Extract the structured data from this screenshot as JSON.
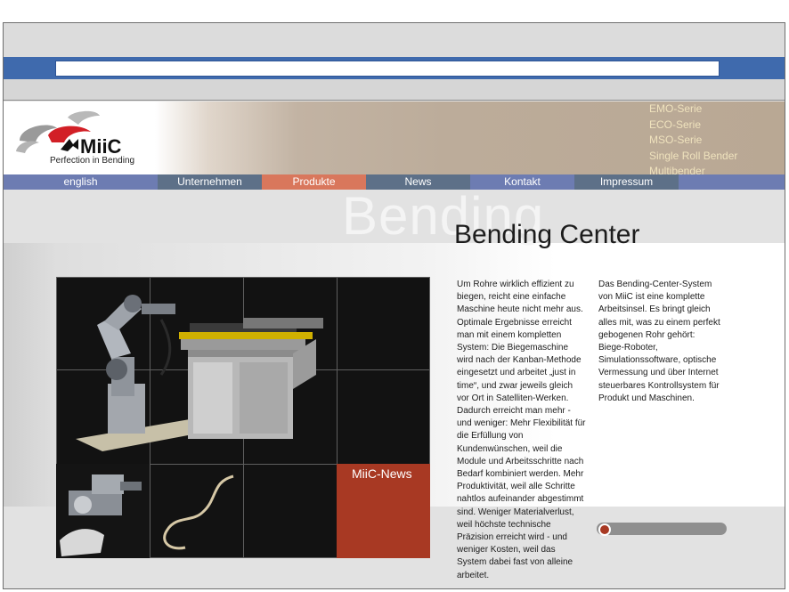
{
  "header": {
    "brand": "MiiC",
    "tagline": "Perfection in Bending",
    "submenu": [
      "EMO-Serie",
      "ECO-Serie",
      "MSO-Serie",
      "Single Roll Bender",
      "Multibender"
    ]
  },
  "nav": {
    "items": [
      {
        "label": "english",
        "color": "#6d7cb2"
      },
      {
        "label": "Unternehmen",
        "color": "#5d7088"
      },
      {
        "label": "Produkte",
        "color": "#d9775c"
      },
      {
        "label": "News",
        "color": "#5d7088"
      },
      {
        "label": "Kontakt",
        "color": "#6d7cb2"
      },
      {
        "label": "Impressum",
        "color": "#5d7088"
      }
    ]
  },
  "main": {
    "watermark": "Bending",
    "title": "Bending Center",
    "news_label": "MiiC-News",
    "col1": "Um Rohre wirklich effizient zu biegen, reicht eine einfache Maschine heute nicht mehr aus. Optimale Ergebnisse erreicht man mit einem kompletten System: Die Biegemaschine wird nach der Kanban-Methode eingesetzt und arbeitet „just in time“, und zwar jeweils gleich vor Ort in Satelliten-Werken. Dadurch erreicht man mehr - und weniger: Mehr Flexibilität für die Erfüllung von Kundenwünschen, weil die Module und Arbeitsschritte nach Bedarf kombiniert werden. Mehr Produktivität, weil alle Schritte nahtlos aufeinander abgestimmt sind. Weniger Materialverlust, weil höchste technische Präzision erreicht wird - und weniger Kosten, weil das System dabei fast von alleine arbeitet.",
    "col2": "Das Bending-Center-System von MiiC ist eine komplette Arbeitsinsel. Es bringt gleich alles mit, was zu einem perfekt gebogenen Rohr gehört: Biege-Roboter, Simulationssoftware, optische Vermessung und über Internet steuerbares Kontrollsystem für Produkt und Maschinen."
  },
  "colors": {
    "accent_red": "#a83923",
    "nav_blue": "#6d7cb2",
    "nav_slate": "#5d7088",
    "nav_active": "#d9775c",
    "browser_blue": "#3f6aad"
  }
}
